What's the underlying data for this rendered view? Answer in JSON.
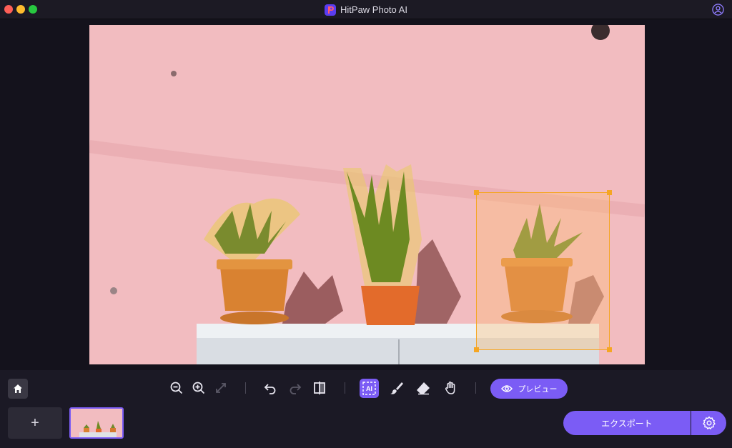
{
  "window": {
    "title": "HitPaw Photo AI"
  },
  "toolbar": {
    "preview_label": "プレビュー",
    "ai_label": "AI"
  },
  "footer": {
    "add_label": "+",
    "export_label": "エクスポート"
  },
  "icons": {
    "app": "hitpaw-logo-icon",
    "account": "user-account-icon",
    "home": "home-icon",
    "zoom_out": "zoom-out-icon",
    "zoom_in": "zoom-in-icon",
    "fit": "fit-screen-icon",
    "undo": "undo-icon",
    "redo": "redo-icon",
    "compare": "compare-icon",
    "brush": "brush-icon",
    "eraser": "eraser-icon",
    "hand": "hand-icon",
    "eye": "eye-icon",
    "settings": "gear-icon"
  },
  "colors": {
    "accent": "#7b5cf5",
    "selection": "#f5a623",
    "background": "#14121c"
  }
}
